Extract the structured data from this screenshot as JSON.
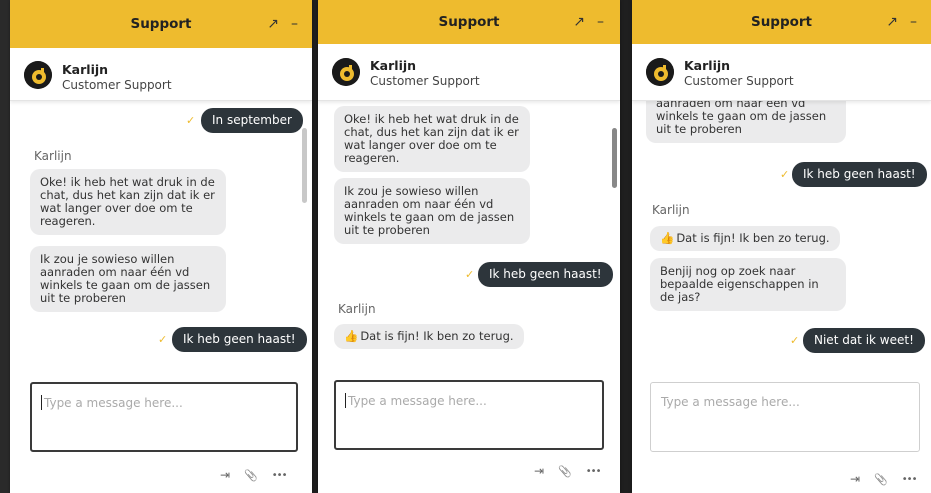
{
  "colors": {
    "brand": "#eebb2e",
    "sent_bubble": "#2d353b",
    "received_bubble": "#ebebec"
  },
  "panels": [
    {
      "header": {
        "title": "Support",
        "expand_icon": "↗",
        "minimize_icon": "–"
      },
      "agent": {
        "name": "Karlijn",
        "role": "Customer Support"
      },
      "messages": {
        "sent_1": "In september",
        "sender": "Karlijn",
        "recv_1": "Oke! ik heb het wat druk in de chat, dus het kan zijn dat ik er wat langer over doe om te reageren.",
        "recv_2": "Ik zou je sowieso willen aanraden om naar één vd winkels te gaan om de jassen uit te proberen",
        "sent_2": "Ik heb geen haast!"
      },
      "input": {
        "placeholder": "Type a message here..."
      }
    },
    {
      "header": {
        "title": "Support",
        "expand_icon": "↗",
        "minimize_icon": "–"
      },
      "agent": {
        "name": "Karlijn",
        "role": "Customer Support"
      },
      "messages": {
        "recv_1": "Oke! ik heb het wat druk in de chat, dus het kan zijn dat ik er wat langer over doe om te reageren.",
        "recv_2": "Ik zou je sowieso willen aanraden om naar één vd winkels te gaan om de jassen uit te proberen",
        "sent_1": "Ik heb geen haast!",
        "sender": "Karlijn",
        "recv_3": "Dat is fijn! Ik ben zo terug."
      },
      "input": {
        "placeholder": "Type a message here..."
      }
    },
    {
      "header": {
        "title": "Support",
        "expand_icon": "↗",
        "minimize_icon": "–"
      },
      "agent": {
        "name": "Karlijn",
        "role": "Customer Support"
      },
      "messages": {
        "recv_1": "aanraden om naar één vd winkels te gaan om de jassen uit te proberen",
        "sent_1": "Ik heb geen haast!",
        "sender": "Karlijn",
        "recv_2": "Dat is fijn! Ik ben zo terug.",
        "recv_3": "Benjij nog op zoek naar bepaalde eigenschappen in de jas?",
        "sent_2": "Niet dat ik weet!"
      },
      "input": {
        "placeholder": "Type a message here..."
      }
    }
  ],
  "icons": {
    "check": "✓",
    "thumbs_up": "👍",
    "exit": "⇥",
    "attach": "📎",
    "more": "•••"
  }
}
